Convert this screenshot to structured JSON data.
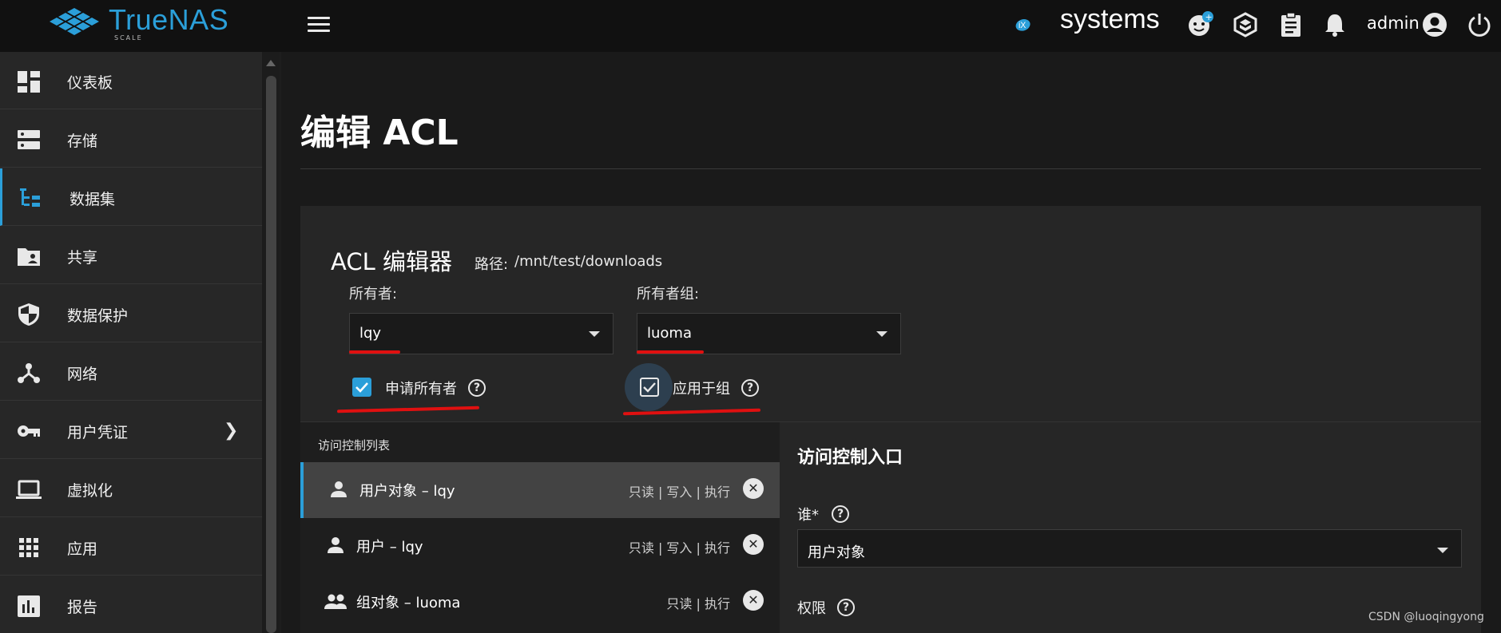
{
  "brand": {
    "name": "TrueNAS",
    "edition": "SCALE",
    "vendor": "systems",
    "accent": "#2b9fd9"
  },
  "topbar": {
    "user": "admin",
    "icons": [
      "feedback-icon",
      "truecommand-icon",
      "tasks-icon",
      "alerts-bell-icon",
      "account-circle-icon",
      "power-icon"
    ]
  },
  "sidebar": {
    "items": [
      {
        "label": "仪表板",
        "icon": "dashboard-icon"
      },
      {
        "label": "存储",
        "icon": "storage-icon"
      },
      {
        "label": "数据集",
        "icon": "datasets-icon",
        "active": true
      },
      {
        "label": "共享",
        "icon": "shares-folder-icon"
      },
      {
        "label": "数据保护",
        "icon": "shield-icon"
      },
      {
        "label": "网络",
        "icon": "network-icon"
      },
      {
        "label": "用户凭证",
        "icon": "key-icon",
        "has_submenu": true
      },
      {
        "label": "虚拟化",
        "icon": "laptop-icon"
      },
      {
        "label": "应用",
        "icon": "apps-grid-icon"
      },
      {
        "label": "报告",
        "icon": "reports-chart-icon"
      }
    ]
  },
  "page": {
    "title": "编辑 ACL"
  },
  "editor": {
    "title": "ACL 编辑器",
    "path_label": "路径:",
    "path_value": "/mnt/test/downloads",
    "owner": {
      "label": "所有者:",
      "value": "lqy"
    },
    "owner_group": {
      "label": "所有者组:",
      "value": "luoma"
    },
    "apply_owner": {
      "label": "申请所有者",
      "checked": true
    },
    "apply_group": {
      "label": "应用于组",
      "checked": true
    }
  },
  "acl_list": {
    "heading": "访问控制列表",
    "entries": [
      {
        "name": "用户对象 – lqy",
        "perms": "只读 | 写入 | 执行",
        "icon": "person-icon",
        "selected": true
      },
      {
        "name": "用户 – lqy",
        "perms": "只读 | 写入 | 执行",
        "icon": "person-icon",
        "selected": false
      },
      {
        "name": "组对象 – luoma",
        "perms": "只读 | 执行",
        "icon": "group-icon",
        "selected": false
      }
    ]
  },
  "entry": {
    "title": "访问控制入口",
    "who_label": "谁*",
    "who_value": "用户对象",
    "permissions_label": "权限"
  },
  "watermark": "CSDN @luoqingyong"
}
